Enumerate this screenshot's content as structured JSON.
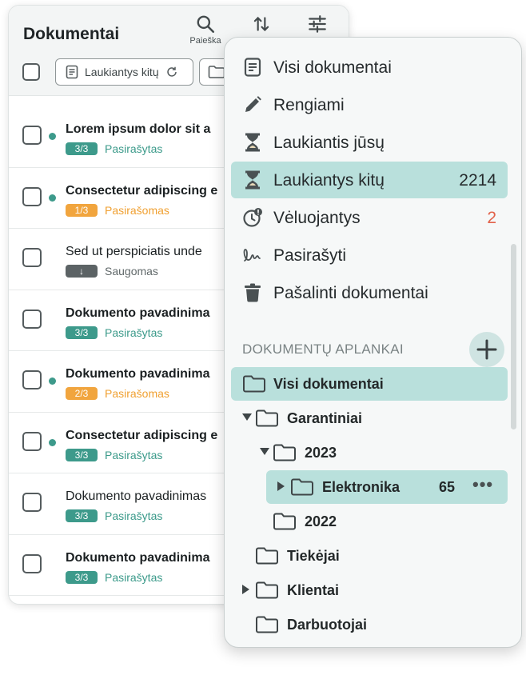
{
  "list": {
    "title": "Dokumentai",
    "tools": [
      {
        "icon": "search-icon",
        "label": "Paieška"
      },
      {
        "icon": "sort-icon",
        "label": ""
      },
      {
        "icon": "filter-sliders-icon",
        "label": ""
      }
    ],
    "filter_chip_label": "Laukiantys kitų",
    "rows": [
      {
        "title": "Lorem ipsum dolor sit a",
        "bold": true,
        "unread": true,
        "badge": "3/3",
        "status": "Pasirašytas",
        "kind": "signed"
      },
      {
        "title": "Consectetur adipiscing e",
        "bold": true,
        "unread": true,
        "badge": "1/3",
        "status": "Pasirašomas",
        "kind": "signing"
      },
      {
        "title": "Sed ut perspiciatis unde",
        "bold": false,
        "unread": false,
        "badge": "↓",
        "status": "Saugomas",
        "kind": "saved"
      },
      {
        "title": "Dokumento pavadinima",
        "bold": true,
        "unread": false,
        "badge": "3/3",
        "status": "Pasirašytas",
        "kind": "signed"
      },
      {
        "title": "Dokumento pavadinima",
        "bold": true,
        "unread": true,
        "badge": "2/3",
        "status": "Pasirašomas",
        "kind": "signing"
      },
      {
        "title": "Consectetur adipiscing e",
        "bold": true,
        "unread": true,
        "badge": "3/3",
        "status": "Pasirašytas",
        "kind": "signed"
      },
      {
        "title": "Dokumento pavadinimas",
        "bold": false,
        "unread": false,
        "badge": "3/3",
        "status": "Pasirašytas",
        "kind": "signed"
      },
      {
        "title": "Dokumento pavadinima",
        "bold": true,
        "unread": false,
        "badge": "3/3",
        "status": "Pasirašytas",
        "kind": "signed"
      }
    ]
  },
  "menu": {
    "items": [
      {
        "icon": "document-icon",
        "label": "Visi dokumentai",
        "count": ""
      },
      {
        "icon": "pencil-icon",
        "label": "Rengiami",
        "count": ""
      },
      {
        "icon": "hourglass-icon",
        "label": "Laukiantis jūsų",
        "count": ""
      },
      {
        "icon": "hourglass-icon",
        "label": "Laukiantys kitų",
        "count": "2214",
        "active": true
      },
      {
        "icon": "clock-alert-icon",
        "label": "Vėluojantys",
        "count": "2"
      },
      {
        "icon": "signature-icon",
        "label": "Pasirašyti",
        "count": ""
      },
      {
        "icon": "trash-icon",
        "label": "Pašalinti dokumentai",
        "count": ""
      }
    ],
    "folders_title": "DOKUMENTŲ APLANKAI",
    "folders": [
      {
        "label": "Visi dokumentai",
        "active": true
      },
      {
        "label": "Garantiniai",
        "caret": "down"
      },
      {
        "label": "2023",
        "caret": "down"
      },
      {
        "label": "Elektronika",
        "caret": "right",
        "count": "65",
        "active": true
      },
      {
        "label": "2022"
      },
      {
        "label": "Tiekėjai"
      },
      {
        "label": "Klientai",
        "caret": "right"
      },
      {
        "label": "Darbuotojai"
      }
    ]
  },
  "colors": {
    "accent": "#3d9a8b",
    "active_bg": "#b9e0dc",
    "pending": "#f1a53e",
    "late": "#e2624a"
  }
}
